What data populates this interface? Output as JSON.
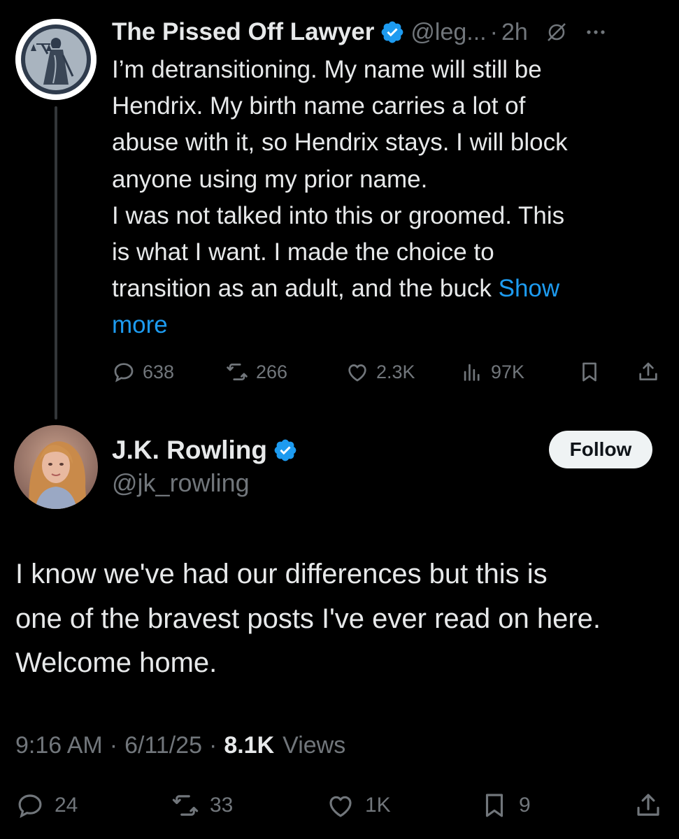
{
  "parent_tweet": {
    "author_name": "The Pissed Off Lawyer",
    "handle": "@leg...",
    "separator": "·",
    "time": "2h",
    "body_lines": [
      "I’m detransitioning. My name will still be",
      "Hendrix. My birth name carries a lot of",
      "abuse with it, so Hendrix stays. I will block",
      "anyone using my prior name.",
      "I was not talked into this or groomed. This",
      "is what I want. I made the choice to"
    ],
    "last_line": "transition as an adult, and the buck",
    "show_more_1": "Show",
    "show_more_2": "more",
    "actions": {
      "replies": "638",
      "reposts": "266",
      "likes": "2.3K",
      "views": "97K"
    },
    "icons": [
      "verified-badge-icon",
      "grok-icon",
      "more-icon",
      "reply-icon",
      "repost-icon",
      "like-icon",
      "views-icon",
      "bookmark-icon",
      "share-icon"
    ]
  },
  "main_tweet": {
    "author_name": "J.K. Rowling",
    "handle": "@jk_rowling",
    "follow_label": "Follow",
    "body_lines": [
      "I know we've had our differences but this is",
      "one of the bravest posts I've ever read on here.",
      "Welcome home."
    ],
    "time": "9:16 AM",
    "sep1": "·",
    "date": "6/11/25",
    "sep2": "·",
    "views_count": "8.1K",
    "views_label": "Views",
    "actions": {
      "replies": "24",
      "reposts": "33",
      "likes": "1K",
      "bookmarks": "9"
    }
  },
  "colors": {
    "background": "#000000",
    "text": "#e7e9ea",
    "secondary": "#71767b",
    "accent": "#1d9bf0",
    "follow_bg": "#eff3f4"
  }
}
